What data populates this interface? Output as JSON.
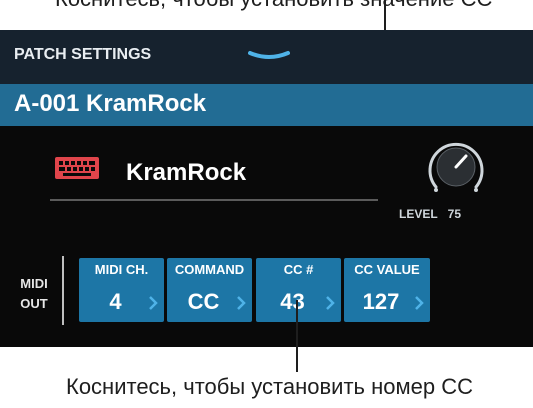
{
  "caption_top": "Коснитесь, чтобы установить значение CC",
  "caption_bottom": "Коснитесь, чтобы установить номер CC",
  "header": {
    "title": "PATCH SETTINGS"
  },
  "patch": {
    "name": "A-001 KramRock",
    "label": "KramRock",
    "icon": "keyboard-icon",
    "icon_color": "#e0454b"
  },
  "level": {
    "label": "LEVEL",
    "value": "75"
  },
  "midi_out": {
    "line1": "MIDI",
    "line2": "OUT"
  },
  "params": [
    {
      "label": "MIDI CH.",
      "value": "4"
    },
    {
      "label": "COMMAND",
      "value": "CC"
    },
    {
      "label": "CC #",
      "value": "43"
    },
    {
      "label": "CC VALUE",
      "value": "127"
    }
  ],
  "colors": {
    "accent": "#1d76a6",
    "patch_bar": "#226c94",
    "chevron": "#4fb3e8"
  }
}
